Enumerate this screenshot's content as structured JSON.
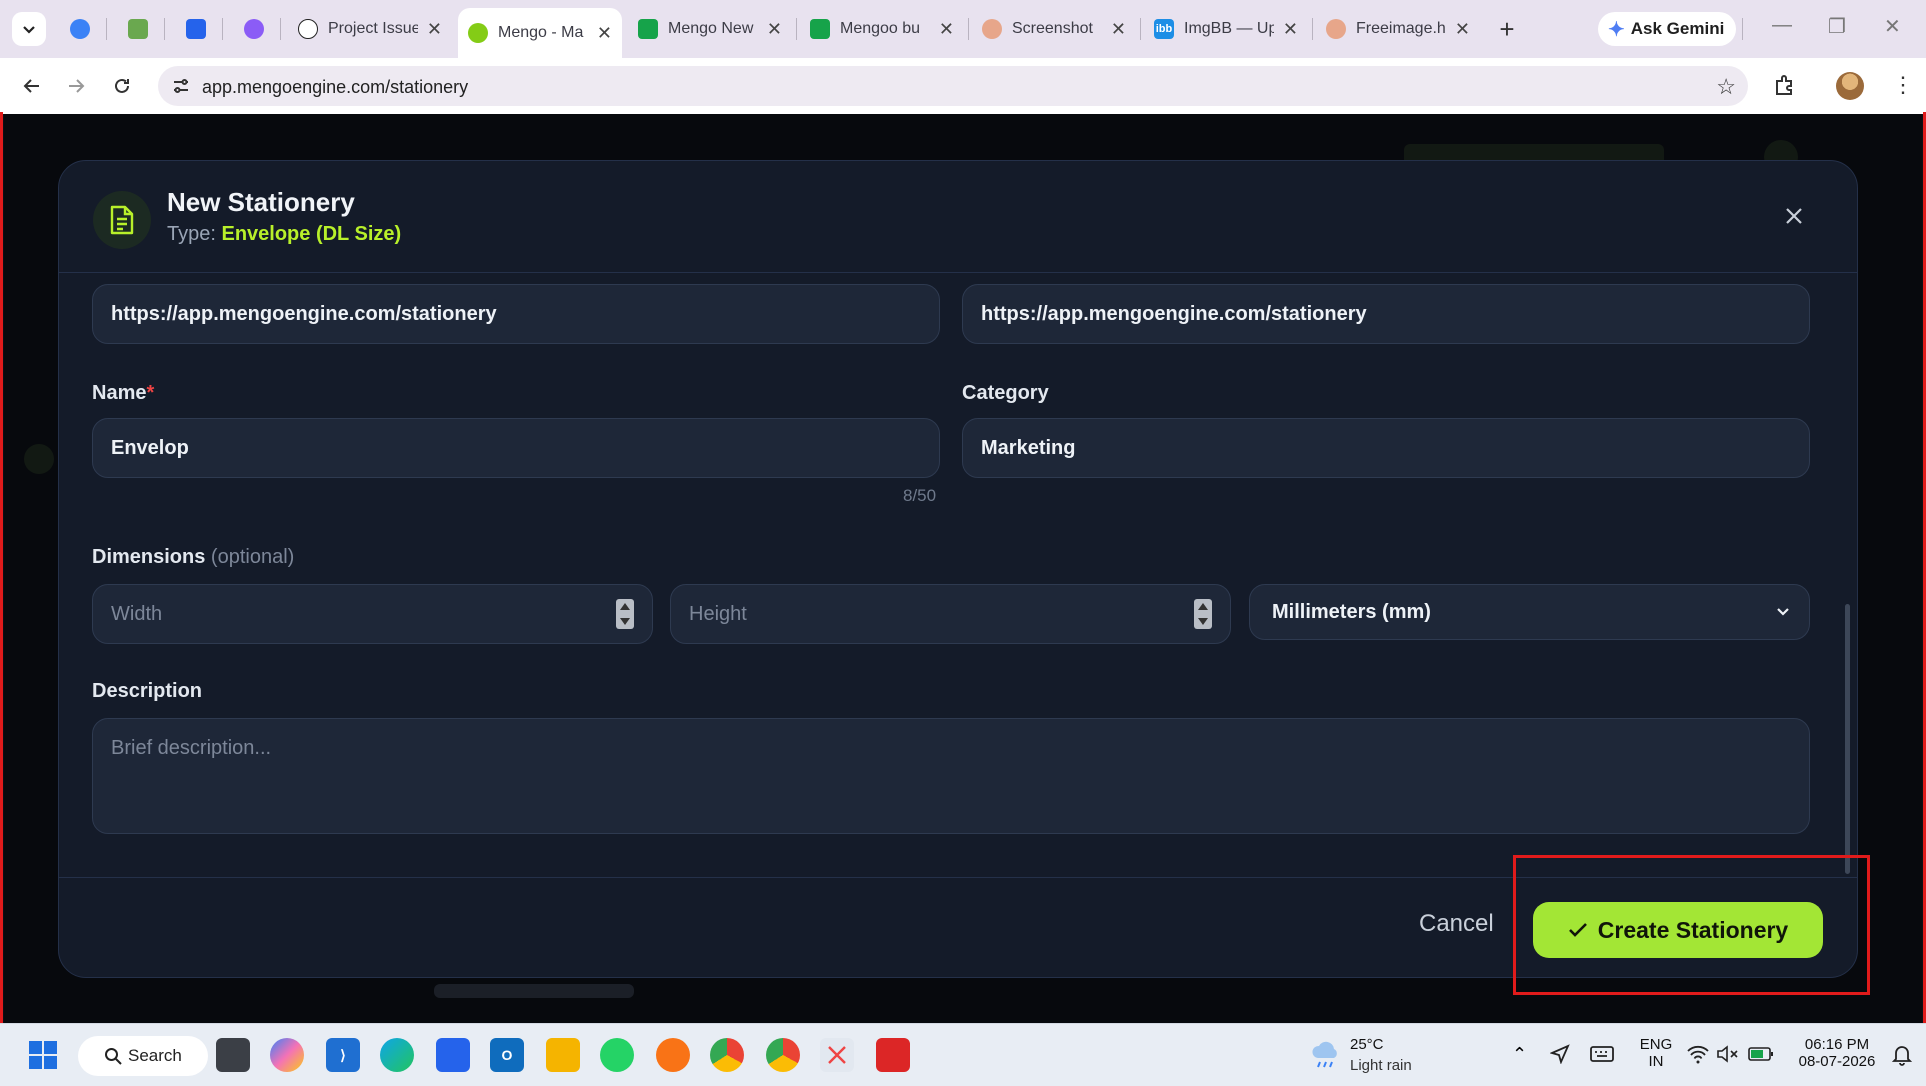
{
  "browser": {
    "tabs": [
      {
        "title": "",
        "favicon": "copilot-icon",
        "color": "#3b82f6"
      },
      {
        "title": "",
        "favicon": "puzzle-icon",
        "color": "#6aa84f"
      },
      {
        "title": "",
        "favicon": "jira-icon",
        "color": "#2563eb"
      },
      {
        "title": "",
        "favicon": "gem-icon",
        "color": "#8b5cf6"
      },
      {
        "title": "Project Issue",
        "favicon": "openai-icon",
        "color": "#222222"
      },
      {
        "title": "Mengo - Ma",
        "favicon": "mengo-icon",
        "color": "#84cc16",
        "active": true
      },
      {
        "title": "Mengo New",
        "favicon": "sheets-icon",
        "color": "#16a34a"
      },
      {
        "title": "Mengoo bu",
        "favicon": "sheets-icon",
        "color": "#16a34a"
      },
      {
        "title": "Screenshot",
        "favicon": "screenshot-icon",
        "color": "#e7a68a"
      },
      {
        "title": "ImgBB — Up",
        "favicon": "imgbb-icon",
        "color": "#1d8ee6"
      },
      {
        "title": "Freeimage.h",
        "favicon": "freeimage-icon",
        "color": "#e7a68a"
      }
    ],
    "gemini_label": "Ask Gemini",
    "url": "app.mengoengine.com/stationery"
  },
  "modal": {
    "title": "New Stationery",
    "type_label": "Type:",
    "type_value": "Envelope (DL Size)",
    "url_field_1": "https://app.mengoengine.com/stationery",
    "url_field_2": "https://app.mengoengine.com/stationery",
    "name_label": "Name",
    "name_required": "*",
    "name_value": "Envelop",
    "name_counter": "8/50",
    "category_label": "Category",
    "category_value": "Marketing",
    "dimensions_label": "Dimensions",
    "dimensions_optional": "(optional)",
    "width_placeholder": "Width",
    "height_placeholder": "Height",
    "unit_value": "Millimeters (mm)",
    "description_label": "Description",
    "description_placeholder": "Brief description...",
    "cancel_label": "Cancel",
    "create_label": "Create Stationery",
    "accent_color": "#a3e635"
  },
  "taskbar": {
    "search_label": "Search",
    "weather_temp": "25°C",
    "weather_desc": "Light rain",
    "lang_top": "ENG",
    "lang_bottom": "IN",
    "time": "06:16 PM",
    "date": "08-07-2026"
  }
}
